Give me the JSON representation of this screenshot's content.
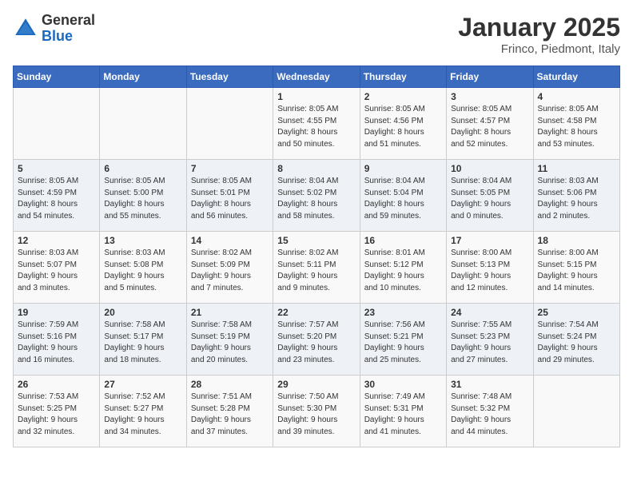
{
  "header": {
    "logo_general": "General",
    "logo_blue": "Blue",
    "cal_title": "January 2025",
    "cal_subtitle": "Frinco, Piedmont, Italy"
  },
  "weekdays": [
    "Sunday",
    "Monday",
    "Tuesday",
    "Wednesday",
    "Thursday",
    "Friday",
    "Saturday"
  ],
  "weeks": [
    [
      {
        "day": "",
        "info": ""
      },
      {
        "day": "",
        "info": ""
      },
      {
        "day": "",
        "info": ""
      },
      {
        "day": "1",
        "info": "Sunrise: 8:05 AM\nSunset: 4:55 PM\nDaylight: 8 hours\nand 50 minutes."
      },
      {
        "day": "2",
        "info": "Sunrise: 8:05 AM\nSunset: 4:56 PM\nDaylight: 8 hours\nand 51 minutes."
      },
      {
        "day": "3",
        "info": "Sunrise: 8:05 AM\nSunset: 4:57 PM\nDaylight: 8 hours\nand 52 minutes."
      },
      {
        "day": "4",
        "info": "Sunrise: 8:05 AM\nSunset: 4:58 PM\nDaylight: 8 hours\nand 53 minutes."
      }
    ],
    [
      {
        "day": "5",
        "info": "Sunrise: 8:05 AM\nSunset: 4:59 PM\nDaylight: 8 hours\nand 54 minutes."
      },
      {
        "day": "6",
        "info": "Sunrise: 8:05 AM\nSunset: 5:00 PM\nDaylight: 8 hours\nand 55 minutes."
      },
      {
        "day": "7",
        "info": "Sunrise: 8:05 AM\nSunset: 5:01 PM\nDaylight: 8 hours\nand 56 minutes."
      },
      {
        "day": "8",
        "info": "Sunrise: 8:04 AM\nSunset: 5:02 PM\nDaylight: 8 hours\nand 58 minutes."
      },
      {
        "day": "9",
        "info": "Sunrise: 8:04 AM\nSunset: 5:04 PM\nDaylight: 8 hours\nand 59 minutes."
      },
      {
        "day": "10",
        "info": "Sunrise: 8:04 AM\nSunset: 5:05 PM\nDaylight: 9 hours\nand 0 minutes."
      },
      {
        "day": "11",
        "info": "Sunrise: 8:03 AM\nSunset: 5:06 PM\nDaylight: 9 hours\nand 2 minutes."
      }
    ],
    [
      {
        "day": "12",
        "info": "Sunrise: 8:03 AM\nSunset: 5:07 PM\nDaylight: 9 hours\nand 3 minutes."
      },
      {
        "day": "13",
        "info": "Sunrise: 8:03 AM\nSunset: 5:08 PM\nDaylight: 9 hours\nand 5 minutes."
      },
      {
        "day": "14",
        "info": "Sunrise: 8:02 AM\nSunset: 5:09 PM\nDaylight: 9 hours\nand 7 minutes."
      },
      {
        "day": "15",
        "info": "Sunrise: 8:02 AM\nSunset: 5:11 PM\nDaylight: 9 hours\nand 9 minutes."
      },
      {
        "day": "16",
        "info": "Sunrise: 8:01 AM\nSunset: 5:12 PM\nDaylight: 9 hours\nand 10 minutes."
      },
      {
        "day": "17",
        "info": "Sunrise: 8:00 AM\nSunset: 5:13 PM\nDaylight: 9 hours\nand 12 minutes."
      },
      {
        "day": "18",
        "info": "Sunrise: 8:00 AM\nSunset: 5:15 PM\nDaylight: 9 hours\nand 14 minutes."
      }
    ],
    [
      {
        "day": "19",
        "info": "Sunrise: 7:59 AM\nSunset: 5:16 PM\nDaylight: 9 hours\nand 16 minutes."
      },
      {
        "day": "20",
        "info": "Sunrise: 7:58 AM\nSunset: 5:17 PM\nDaylight: 9 hours\nand 18 minutes."
      },
      {
        "day": "21",
        "info": "Sunrise: 7:58 AM\nSunset: 5:19 PM\nDaylight: 9 hours\nand 20 minutes."
      },
      {
        "day": "22",
        "info": "Sunrise: 7:57 AM\nSunset: 5:20 PM\nDaylight: 9 hours\nand 23 minutes."
      },
      {
        "day": "23",
        "info": "Sunrise: 7:56 AM\nSunset: 5:21 PM\nDaylight: 9 hours\nand 25 minutes."
      },
      {
        "day": "24",
        "info": "Sunrise: 7:55 AM\nSunset: 5:23 PM\nDaylight: 9 hours\nand 27 minutes."
      },
      {
        "day": "25",
        "info": "Sunrise: 7:54 AM\nSunset: 5:24 PM\nDaylight: 9 hours\nand 29 minutes."
      }
    ],
    [
      {
        "day": "26",
        "info": "Sunrise: 7:53 AM\nSunset: 5:25 PM\nDaylight: 9 hours\nand 32 minutes."
      },
      {
        "day": "27",
        "info": "Sunrise: 7:52 AM\nSunset: 5:27 PM\nDaylight: 9 hours\nand 34 minutes."
      },
      {
        "day": "28",
        "info": "Sunrise: 7:51 AM\nSunset: 5:28 PM\nDaylight: 9 hours\nand 37 minutes."
      },
      {
        "day": "29",
        "info": "Sunrise: 7:50 AM\nSunset: 5:30 PM\nDaylight: 9 hours\nand 39 minutes."
      },
      {
        "day": "30",
        "info": "Sunrise: 7:49 AM\nSunset: 5:31 PM\nDaylight: 9 hours\nand 41 minutes."
      },
      {
        "day": "31",
        "info": "Sunrise: 7:48 AM\nSunset: 5:32 PM\nDaylight: 9 hours\nand 44 minutes."
      },
      {
        "day": "",
        "info": ""
      }
    ]
  ]
}
